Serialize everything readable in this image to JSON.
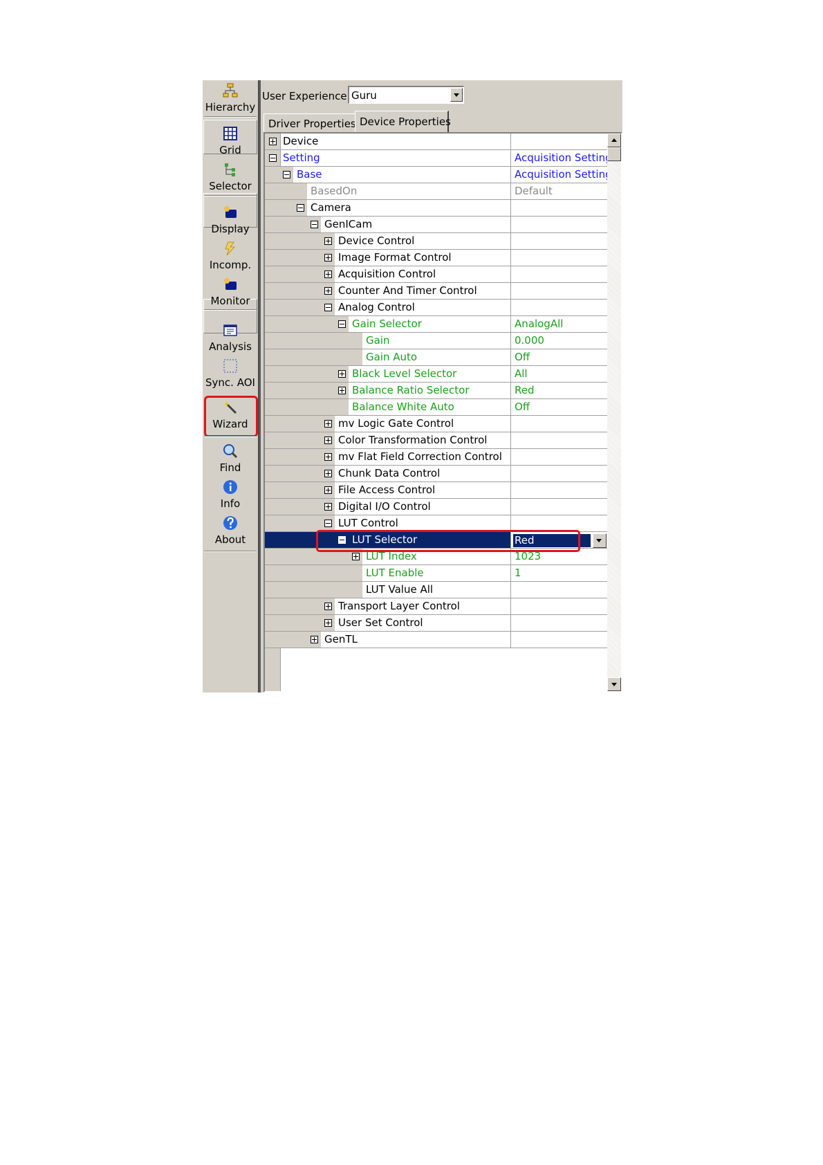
{
  "toolbar": {
    "items": [
      {
        "label": "Hierarchy",
        "icon": "hierarchy-icon"
      },
      {
        "label": "Grid",
        "icon": "grid-icon"
      },
      {
        "label": "Selector",
        "icon": "selector-icon"
      },
      {
        "label": "Display",
        "icon": "display-icon"
      },
      {
        "label": "Incomp.",
        "icon": "incomp-icon"
      },
      {
        "label": "Monitor",
        "icon": "monitor-icon"
      },
      {
        "label": "Analysis",
        "icon": "analysis-icon"
      },
      {
        "label": "Sync. AOI",
        "icon": "sync-aoi-icon"
      },
      {
        "label": "Wizard",
        "icon": "wizard-icon"
      },
      {
        "label": "Find",
        "icon": "find-icon"
      },
      {
        "label": "Info",
        "icon": "info-icon"
      },
      {
        "label": "About",
        "icon": "about-icon"
      }
    ]
  },
  "user_experience": {
    "label": "User Experience:",
    "value": "Guru"
  },
  "tabs": [
    {
      "label": "Driver Properties",
      "active": false
    },
    {
      "label": "Device Properties",
      "active": true
    }
  ],
  "colors": {
    "blue": "#1a1aff",
    "green": "#1aa01a",
    "gray": "#8a8a8a",
    "selection": "#0a246a",
    "highlight": "#e0141e"
  },
  "rows": [
    {
      "name": "Device",
      "value": "",
      "expander": "plus",
      "color": "black"
    },
    {
      "name": "Setting",
      "value": "Acquisition Setting",
      "expander": "minus",
      "color": "blue"
    },
    {
      "name": "Base",
      "value": "Acquisition Setting",
      "expander": "minus",
      "color": "blue"
    },
    {
      "name": "BasedOn",
      "value": "Default",
      "expander": "",
      "color": "gray"
    },
    {
      "name": "Camera",
      "value": "",
      "expander": "minus",
      "color": "black"
    },
    {
      "name": "GenICam",
      "value": "",
      "expander": "minus",
      "color": "black"
    },
    {
      "name": "Device Control",
      "value": "",
      "expander": "plus",
      "color": "black"
    },
    {
      "name": "Image Format Control",
      "value": "",
      "expander": "plus",
      "color": "black"
    },
    {
      "name": "Acquisition Control",
      "value": "",
      "expander": "plus",
      "color": "black"
    },
    {
      "name": "Counter And Timer Control",
      "value": "",
      "expander": "plus",
      "color": "black"
    },
    {
      "name": "Analog Control",
      "value": "",
      "expander": "minus",
      "color": "black"
    },
    {
      "name": "Gain Selector",
      "value": "AnalogAll",
      "expander": "minus",
      "color": "green"
    },
    {
      "name": "Gain",
      "value": "0.000",
      "expander": "",
      "color": "green"
    },
    {
      "name": "Gain Auto",
      "value": "Off",
      "expander": "",
      "color": "green"
    },
    {
      "name": "Black Level Selector",
      "value": "All",
      "expander": "plus",
      "color": "green"
    },
    {
      "name": "Balance Ratio Selector",
      "value": "Red",
      "expander": "plus",
      "color": "green"
    },
    {
      "name": "Balance White Auto",
      "value": "Off",
      "expander": "",
      "color": "green"
    },
    {
      "name": "mv Logic Gate Control",
      "value": "",
      "expander": "plus",
      "color": "black"
    },
    {
      "name": "Color Transformation Control",
      "value": "",
      "expander": "plus",
      "color": "black"
    },
    {
      "name": "mv Flat Field Correction Control",
      "value": "",
      "expander": "plus",
      "color": "black"
    },
    {
      "name": "Chunk Data Control",
      "value": "",
      "expander": "plus",
      "color": "black"
    },
    {
      "name": "File Access Control",
      "value": "",
      "expander": "plus",
      "color": "black"
    },
    {
      "name": "Digital I/O Control",
      "value": "",
      "expander": "plus",
      "color": "black"
    },
    {
      "name": "LUT Control",
      "value": "",
      "expander": "minus",
      "color": "black"
    },
    {
      "name": "LUT Selector",
      "value": "Red",
      "expander": "minus",
      "color": "selected"
    },
    {
      "name": "LUT Index",
      "value": "1023",
      "expander": "plus",
      "color": "green"
    },
    {
      "name": "LUT Enable",
      "value": "1",
      "expander": "",
      "color": "green"
    },
    {
      "name": "LUT Value All",
      "value": "",
      "expander": "",
      "color": "black"
    },
    {
      "name": "Transport Layer Control",
      "value": "",
      "expander": "plus",
      "color": "black"
    },
    {
      "name": "User Set Control",
      "value": "",
      "expander": "plus",
      "color": "black"
    },
    {
      "name": "GenTL",
      "value": "",
      "expander": "plus",
      "color": "black"
    }
  ]
}
